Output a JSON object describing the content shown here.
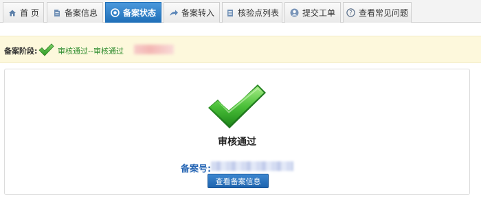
{
  "tabs": [
    {
      "label": "首 页",
      "icon": "home-icon",
      "active": false
    },
    {
      "label": "备案信息",
      "icon": "document-icon",
      "active": false
    },
    {
      "label": "备案状态",
      "icon": "status-icon",
      "active": true
    },
    {
      "label": "备案转入",
      "icon": "transfer-arrow-icon",
      "active": false
    },
    {
      "label": "核验点列表",
      "icon": "list-book-icon",
      "active": false
    },
    {
      "label": "提交工单",
      "icon": "user-icon",
      "active": false
    },
    {
      "label": "查看常见问题",
      "icon": "question-icon",
      "active": false
    }
  ],
  "status_strip": {
    "label": "备案阶段:",
    "status_text": "审核通过--审核通过"
  },
  "result": {
    "title": "审核通过",
    "record_label": "备案号:",
    "button_label": "查看备案信息"
  },
  "colors": {
    "active_tab": "#2a7fc9",
    "success_green": "#2f8c2f",
    "strip_background": "#fdf8dc",
    "record_label_blue": "#2766b4",
    "button_blue": "#2a74c0"
  }
}
